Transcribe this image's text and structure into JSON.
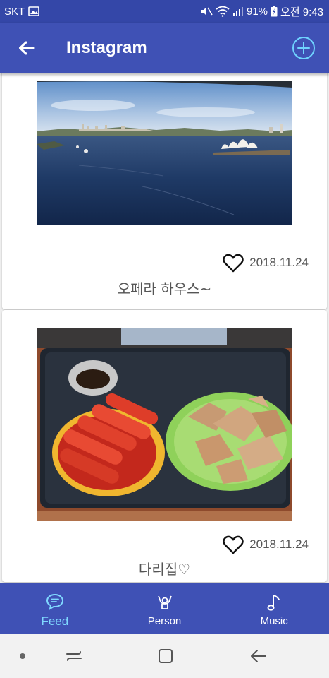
{
  "status_bar": {
    "carrier": "SKT",
    "battery": "91%",
    "time": "오전 9:43"
  },
  "app_bar": {
    "title": "Instagram",
    "back_icon": "arrow-left-icon",
    "add_icon": "plus-circle-icon"
  },
  "posts": [
    {
      "photo": "sydney-harbour-opera-house-photo",
      "like_icon": "heart-outline-icon",
      "date": "2018.11.24",
      "caption": "오페라 하우스~"
    },
    {
      "photo": "tteokbokki-and-fried-dumplings-photo",
      "like_icon": "heart-outline-icon",
      "date": "2018.11.24",
      "caption": "다리집♡"
    }
  ],
  "bottom_nav": {
    "items": [
      {
        "label": "Feed",
        "icon": "chat-bubble-icon",
        "active": true
      },
      {
        "label": "Person",
        "icon": "person-raised-hands-icon",
        "active": false
      },
      {
        "label": "Music",
        "icon": "music-note-icon",
        "active": false
      }
    ]
  },
  "colors": {
    "primary": "#3f51b5",
    "status_bar": "#3447a8",
    "active_nav": "#7fd8ff",
    "background": "#eeeeee"
  }
}
